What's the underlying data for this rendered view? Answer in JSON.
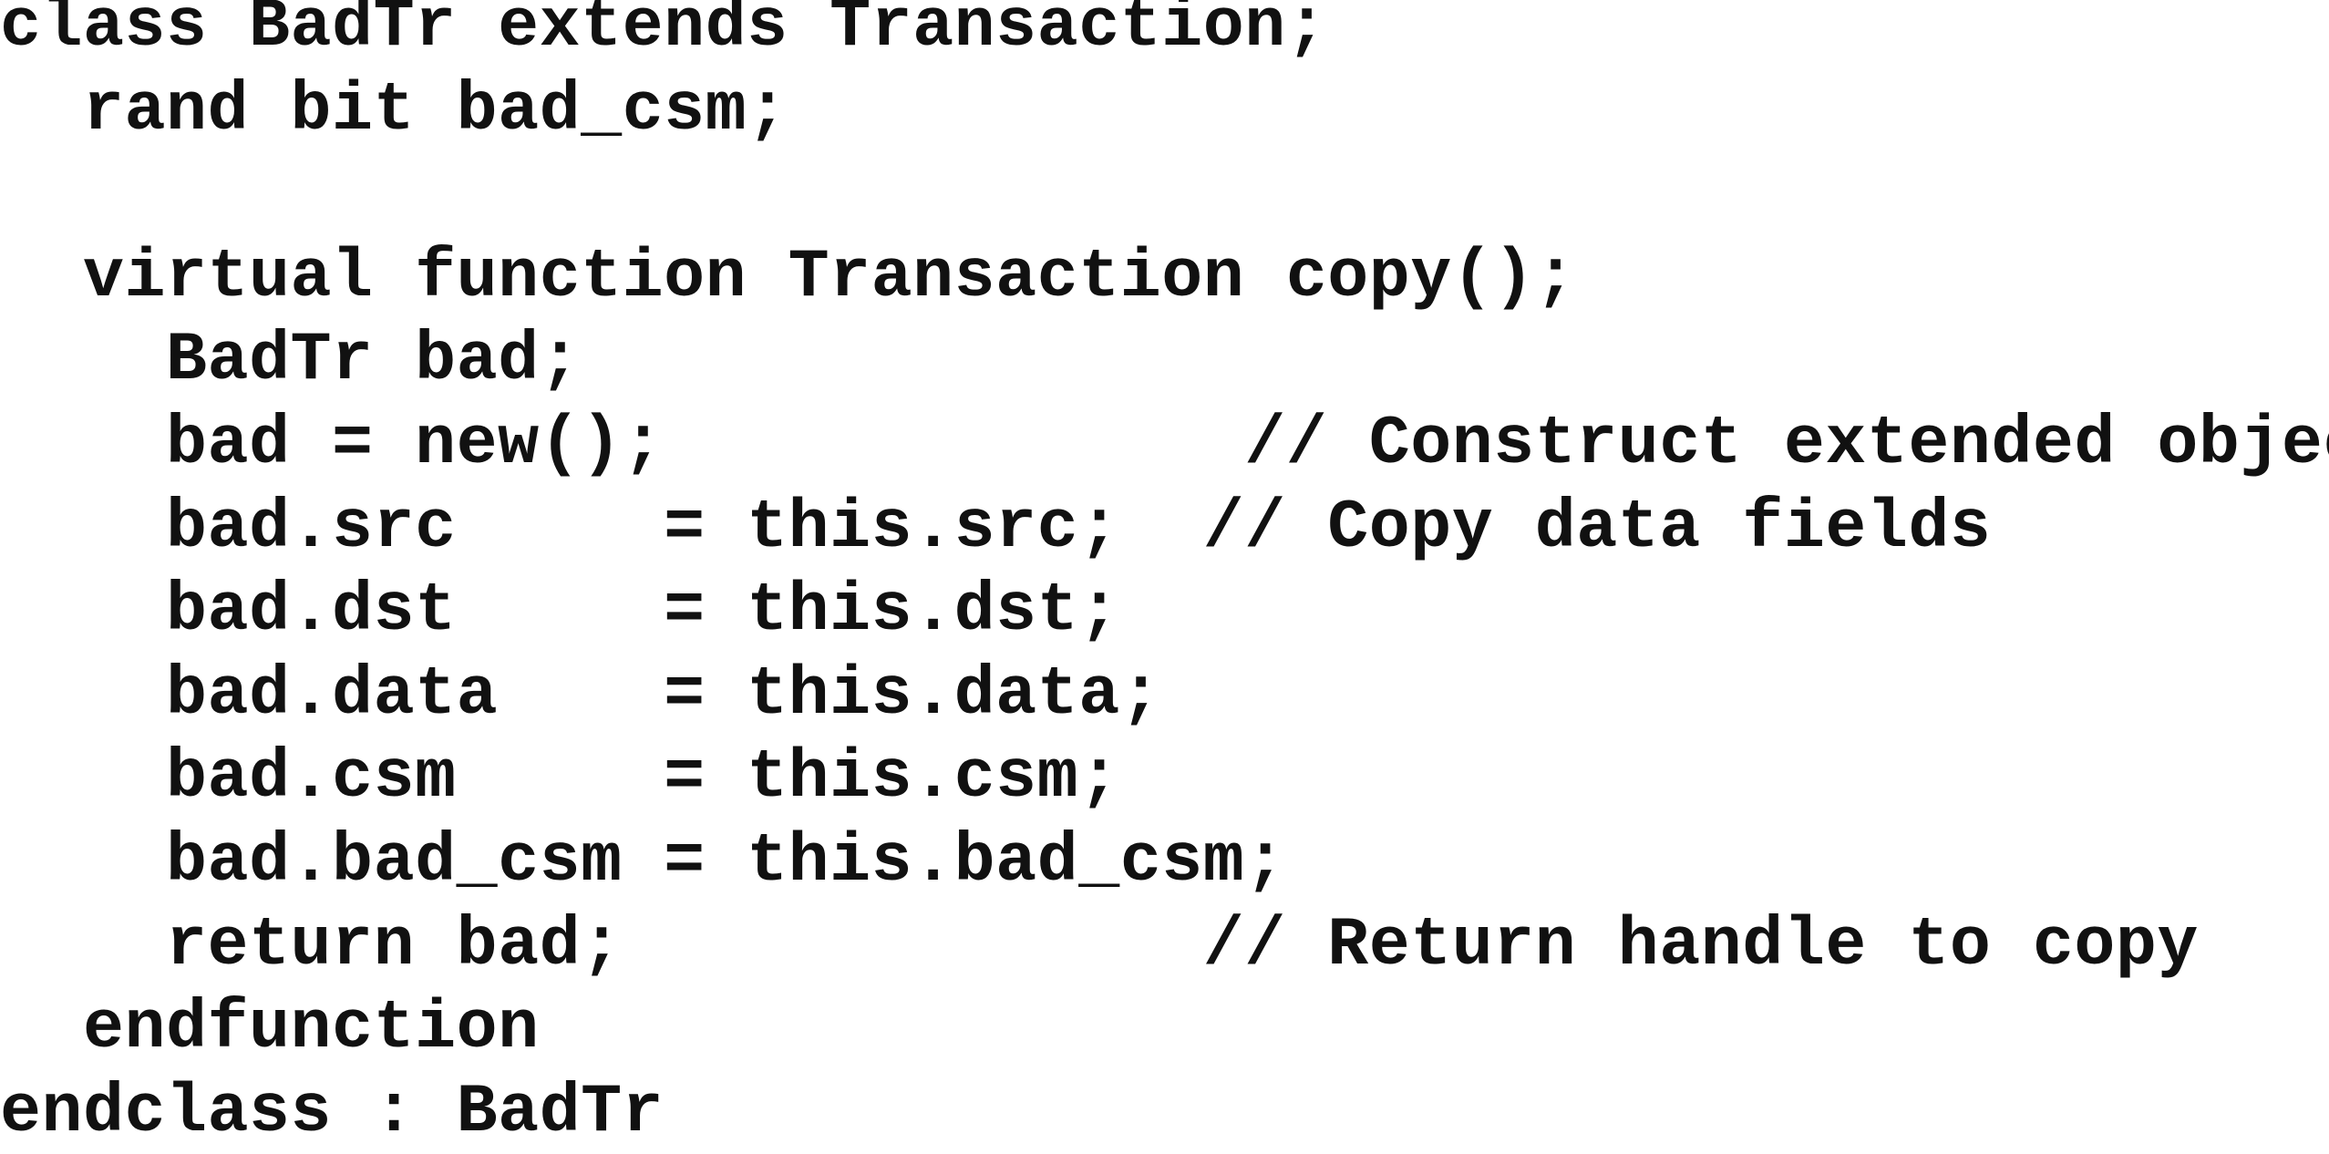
{
  "code": {
    "lines": [
      "class BadTr extends Transaction;",
      "  rand bit bad_csm;",
      "",
      "  virtual function Transaction copy();",
      "    BadTr bad;",
      "    bad = new();              // Construct extended object",
      "    bad.src     = this.src;  // Copy data fields",
      "    bad.dst     = this.dst;",
      "    bad.data    = this.data;",
      "    bad.csm     = this.csm;",
      "    bad.bad_csm = this.bad_csm;",
      "    return bad;              // Return handle to copy",
      "  endfunction",
      "endclass : BadTr"
    ]
  }
}
